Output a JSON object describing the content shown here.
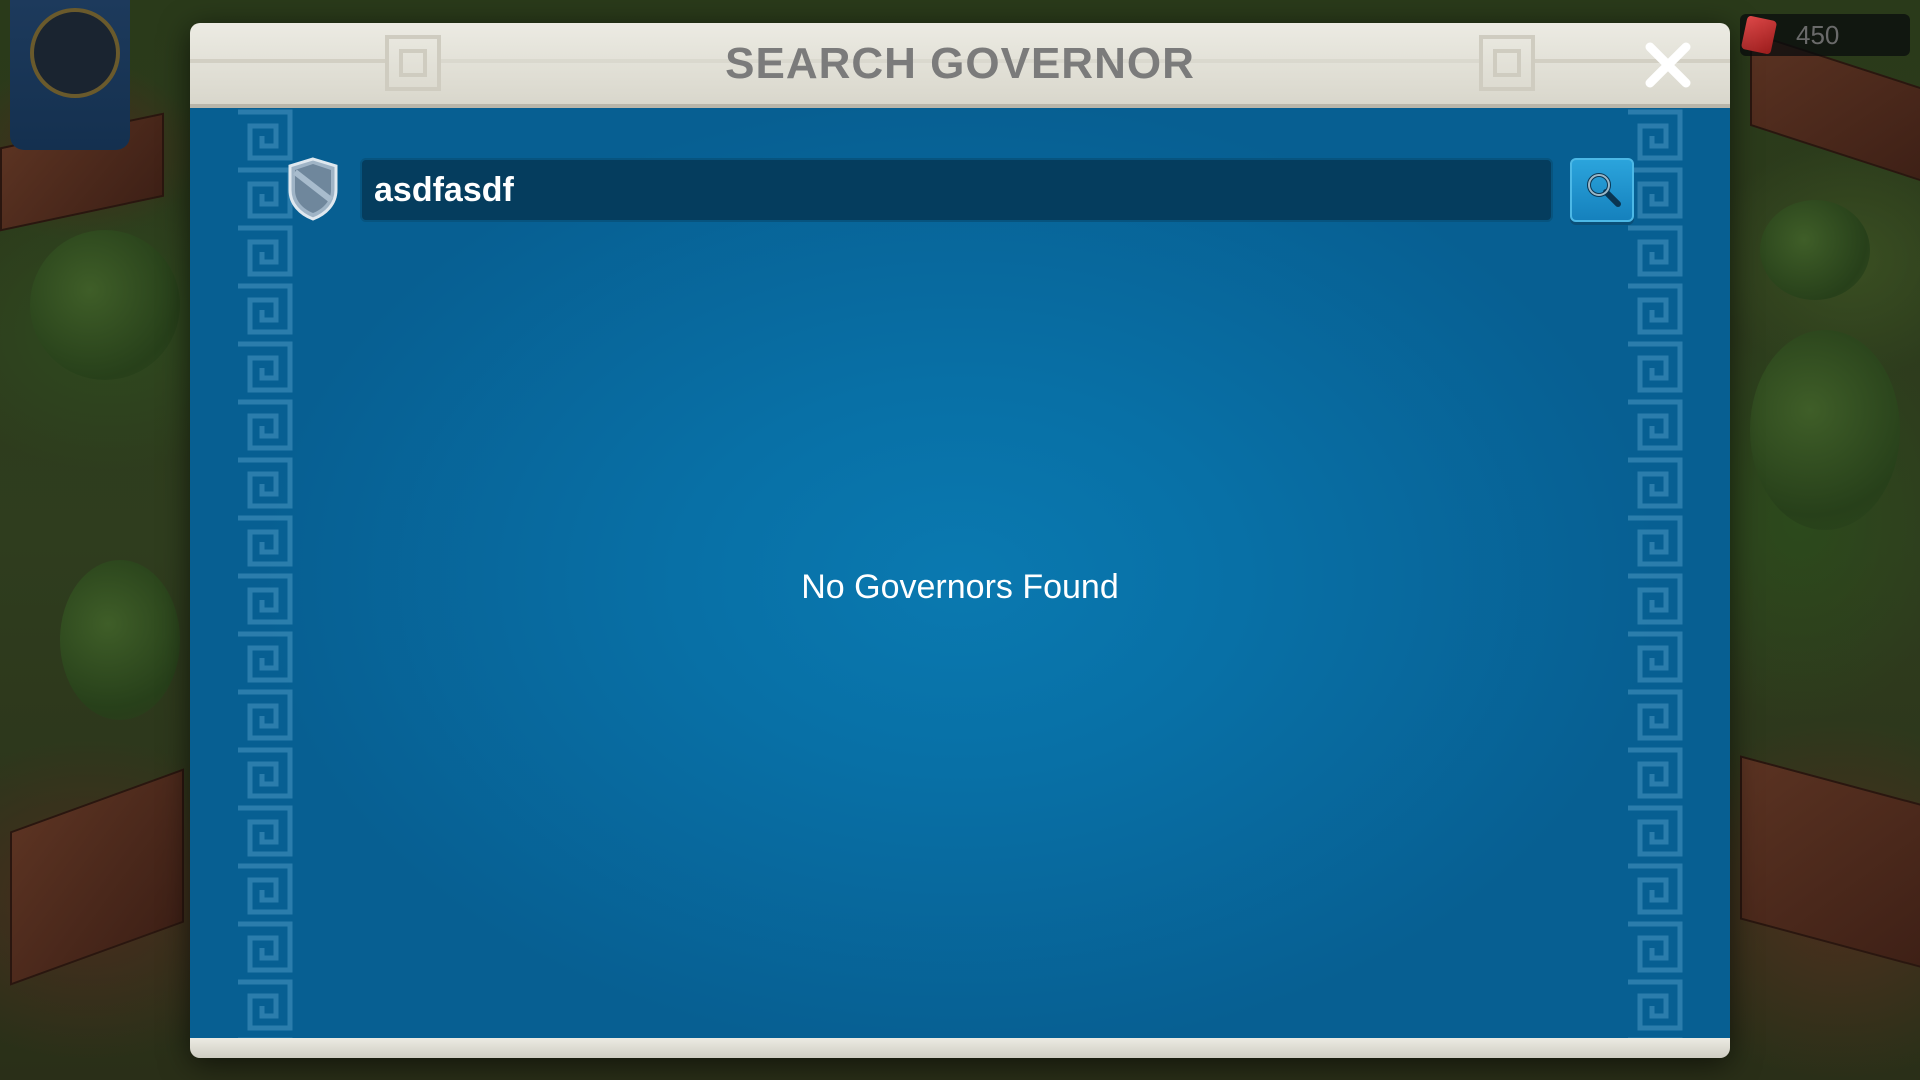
{
  "hud": {
    "gem_count": "450"
  },
  "dialog": {
    "title": "SEARCH GOVERNOR",
    "close_icon": "close-x-icon",
    "search": {
      "value": "asdfasdf",
      "shield_icon": "shield-icon",
      "button_icon": "magnifier-icon"
    },
    "empty_message": "No Governors Found"
  },
  "colors": {
    "header_bg": "#e4e2d8",
    "title_text": "#7b7b7b",
    "body_bg": "#0870a6",
    "input_bg": "#053d5e",
    "search_button": "#1e94cf"
  }
}
